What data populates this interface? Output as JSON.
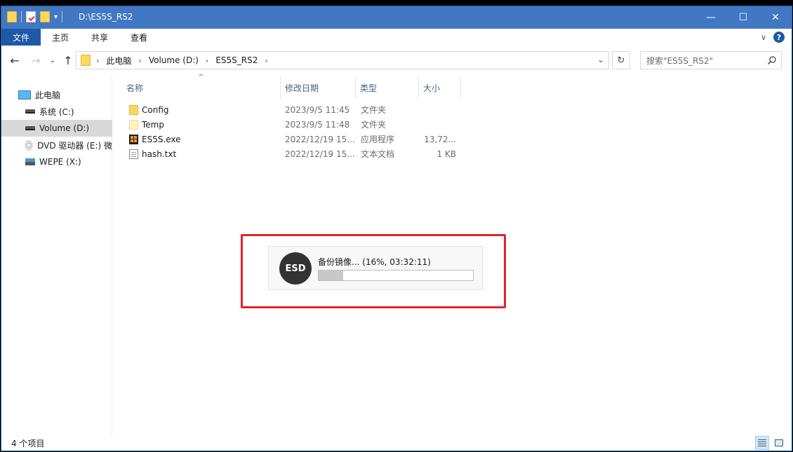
{
  "window": {
    "title": "D:\\ES5S_RS2",
    "controls": {
      "minimize": "—",
      "maximize": "☐",
      "close": "✕"
    }
  },
  "ribbon": {
    "tabs": [
      "文件",
      "主页",
      "共享",
      "查看"
    ],
    "help": "?"
  },
  "address": {
    "crumbs": [
      "此电脑",
      "Volume (D:)",
      "ES5S_RS2"
    ],
    "search_placeholder": "搜索\"ES5S_RS2\""
  },
  "sidebar": {
    "items": [
      {
        "label": "此电脑",
        "icon": "computer-icon"
      },
      {
        "label": "系统 (C:)",
        "icon": "drive-icon"
      },
      {
        "label": "Volume (D:)",
        "icon": "drive-icon",
        "selected": true
      },
      {
        "label": "DVD 驱动器 (E:) 微",
        "icon": "dvd-icon"
      },
      {
        "label": "WEPE (X:)",
        "icon": "usb-drive-icon"
      }
    ]
  },
  "columns": {
    "name": "名称",
    "modified": "修改日期",
    "type": "类型",
    "size": "大小"
  },
  "files": [
    {
      "name": "Config",
      "modified": "2023/9/5 11:45",
      "type": "文件夹",
      "size": "",
      "icon": "folder-icon"
    },
    {
      "name": "Temp",
      "modified": "2023/9/5 11:48",
      "type": "文件夹",
      "size": "",
      "icon": "folder-icon"
    },
    {
      "name": "ES5S.exe",
      "modified": "2022/12/19 15...",
      "type": "应用程序",
      "size": "13,72...",
      "icon": "exe-icon"
    },
    {
      "name": "hash.txt",
      "modified": "2022/12/19 15...",
      "type": "文本文档",
      "size": "1 KB",
      "icon": "text-file-icon"
    }
  ],
  "progress": {
    "badge": "ESD",
    "text": "备份镜像... (16%, 03:32:11)",
    "percent": 16
  },
  "status": {
    "item_count": "4 个项目"
  }
}
